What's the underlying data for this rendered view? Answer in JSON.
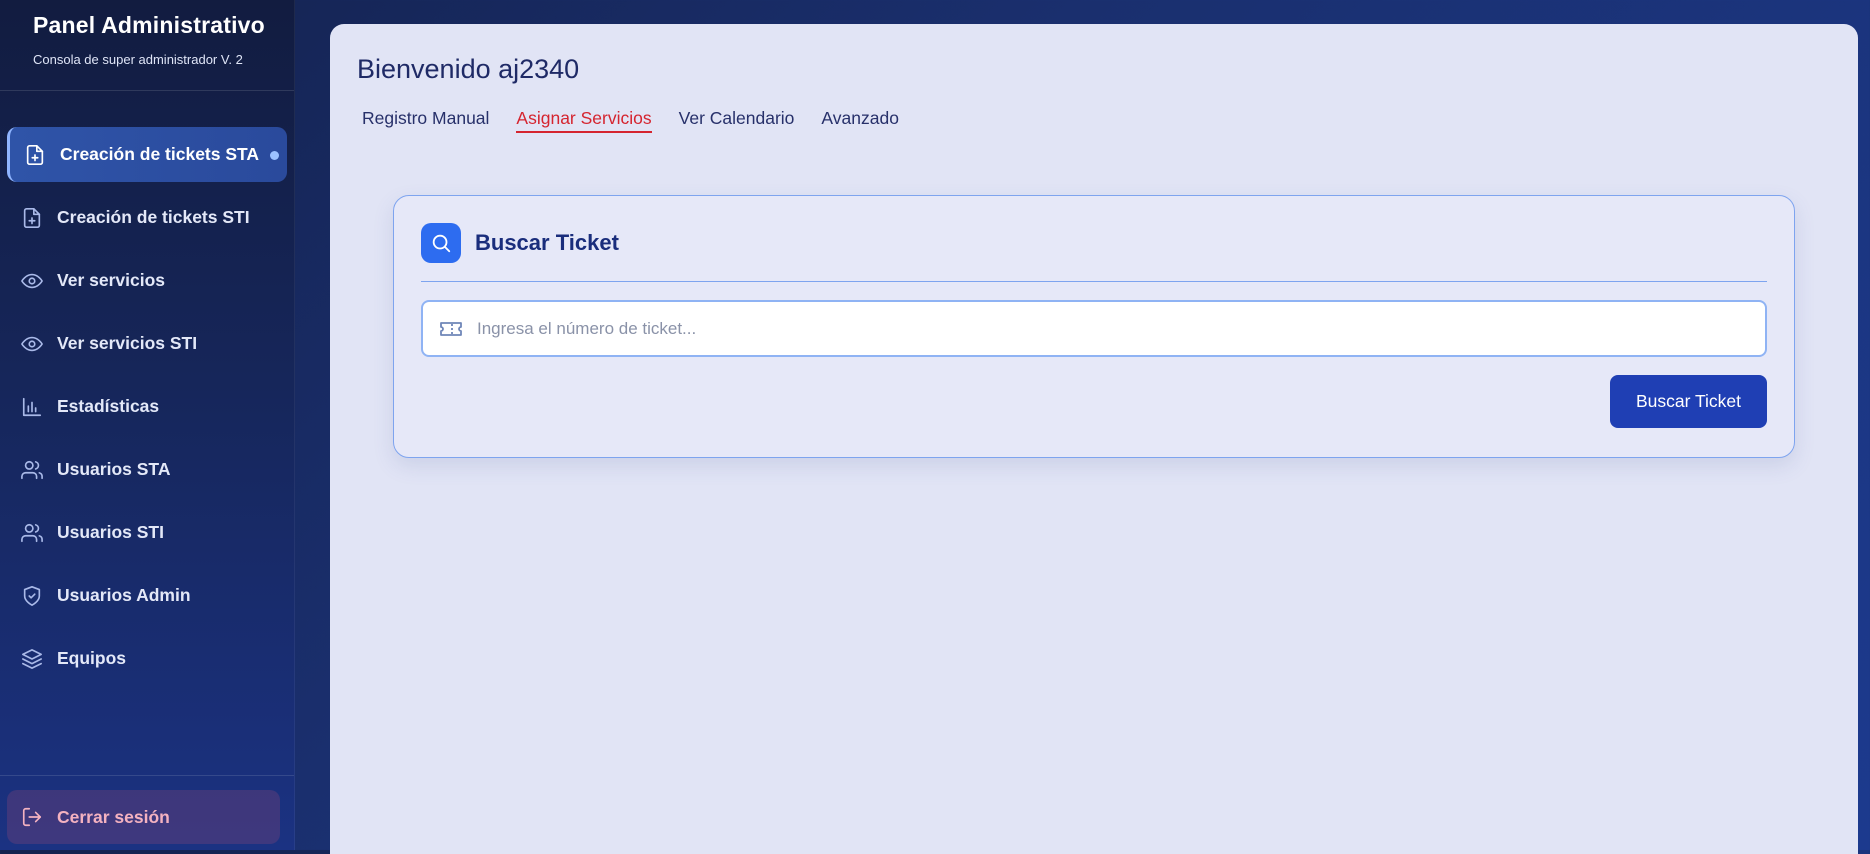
{
  "sidebar": {
    "title": "Panel Administrativo",
    "subtitle": "Consola de super administrador V. 2",
    "items": [
      {
        "label": "Creación de tickets STA",
        "icon": "file-plus-icon",
        "active": true
      },
      {
        "label": "Creación de tickets STI",
        "icon": "file-plus-icon"
      },
      {
        "label": "Ver servicios",
        "icon": "eye-icon"
      },
      {
        "label": "Ver servicios STI",
        "icon": "eye-icon"
      },
      {
        "label": "Estadísticas",
        "icon": "bar-chart-icon"
      },
      {
        "label": "Usuarios STA",
        "icon": "users-icon"
      },
      {
        "label": "Usuarios STI",
        "icon": "users-icon"
      },
      {
        "label": "Usuarios Admin",
        "icon": "shield-icon"
      },
      {
        "label": "Equipos",
        "icon": "layers-icon"
      }
    ],
    "logout_label": "Cerrar sesión"
  },
  "main": {
    "welcome": "Bienvenido aj2340",
    "tabs": [
      {
        "label": "Registro Manual"
      },
      {
        "label": "Asignar Servicios",
        "active": true
      },
      {
        "label": "Ver Calendario"
      },
      {
        "label": "Avanzado"
      }
    ],
    "search_card": {
      "title": "Buscar Ticket",
      "placeholder": "Ingresa el número de ticket...",
      "button_label": "Buscar Ticket"
    }
  },
  "colors": {
    "accent": "#1f3fb4",
    "active_tab": "#d5242f",
    "card_border": "#7ea4ef"
  }
}
